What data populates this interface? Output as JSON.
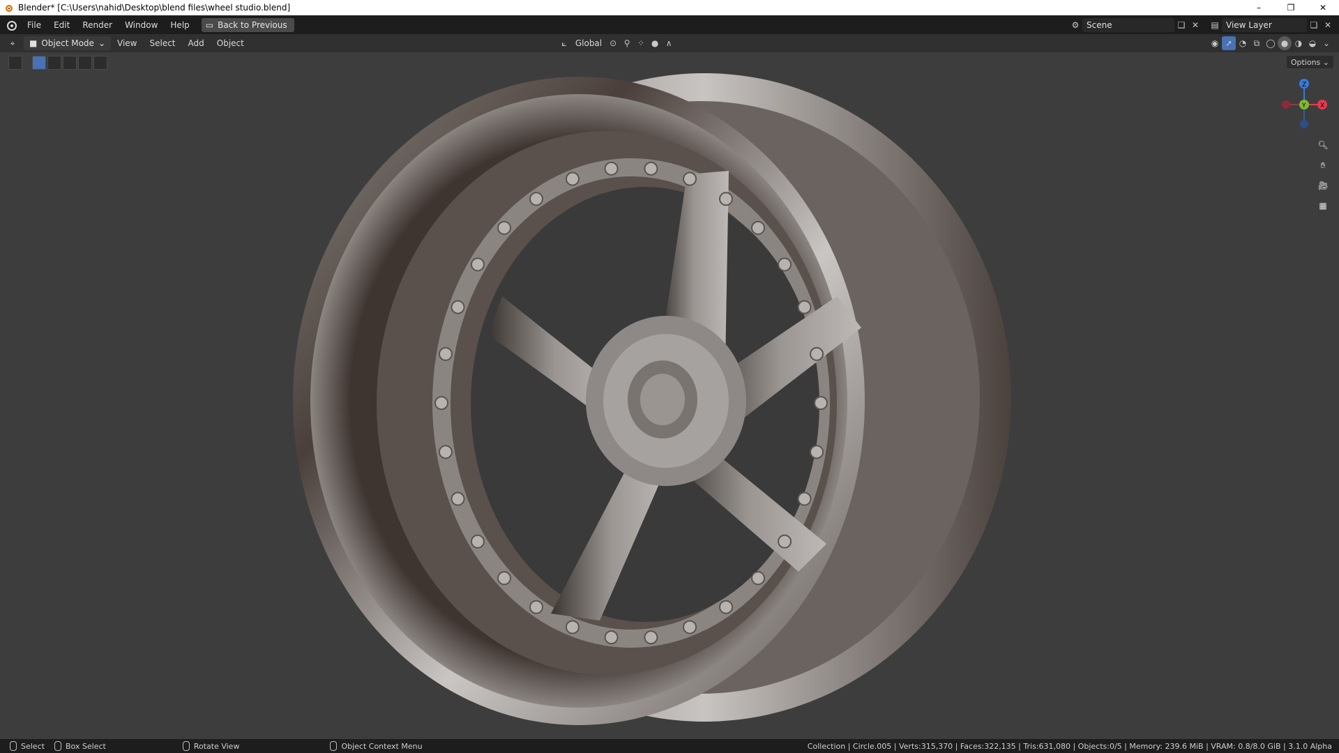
{
  "window": {
    "title": "Blender* [C:\\Users\\nahid\\Desktop\\blend files\\wheel studio.blend]",
    "controls": {
      "minimize": "–",
      "restore": "❐",
      "close": "✕"
    }
  },
  "topbar": {
    "menus": [
      "File",
      "Edit",
      "Render",
      "Window",
      "Help"
    ],
    "back_button": "Back to Previous",
    "scene_label": "Scene",
    "view_layer_label": "View Layer"
  },
  "header": {
    "mode": "Object Mode",
    "menus": [
      "View",
      "Select",
      "Add",
      "Object"
    ],
    "orientation": "Global",
    "options": "Options"
  },
  "statusbar": {
    "hints": [
      "Select",
      "Box Select",
      "Rotate View",
      "Object Context Menu"
    ],
    "info": "Collection | Circle.005 | Verts:315,370 | Faces:322,135 | Tris:631,080 | Objects:0/5 | Memory: 239.6 MiB | VRAM: 0.8/8.0 GiB | 3.1.0 Alpha"
  },
  "gizmo": {
    "axes": [
      "X",
      "Y",
      "Z"
    ],
    "colors": {
      "x": "#e83a4e",
      "y": "#7dbb2f",
      "z": "#3a7ad8"
    }
  },
  "colors": {
    "accent": "#4772b3",
    "viewport_bg": "#3d3d3d"
  }
}
